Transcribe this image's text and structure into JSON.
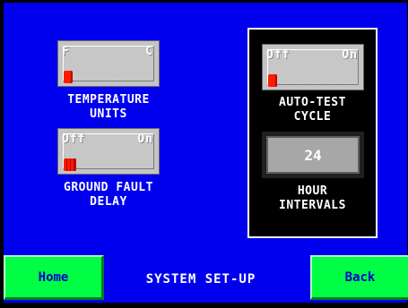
{
  "temperature": {
    "left_label": "F",
    "right_label": "C",
    "caption_line1": "TEMPERATURE",
    "caption_line2": "UNITS",
    "selected": "F"
  },
  "ground_fault": {
    "left_label": "Off",
    "right_label": "On",
    "caption_line1": "GROUND FAULT",
    "caption_line2": "DELAY",
    "selected": "Off"
  },
  "auto_test": {
    "left_label": "Off",
    "right_label": "On",
    "caption_line1": "AUTO-TEST",
    "caption_line2": "CYCLE",
    "selected": "Off"
  },
  "hour_intervals": {
    "value": "24",
    "caption_line1": "HOUR",
    "caption_line2": "INTERVALS"
  },
  "footer": {
    "home_label": "Home",
    "title": "SYSTEM SET-UP",
    "back_label": "Back"
  },
  "colors": {
    "background": "#0000ee",
    "button_green": "#00ff44",
    "knob_red": "#ff1a00",
    "text_white": "#ffffff"
  }
}
